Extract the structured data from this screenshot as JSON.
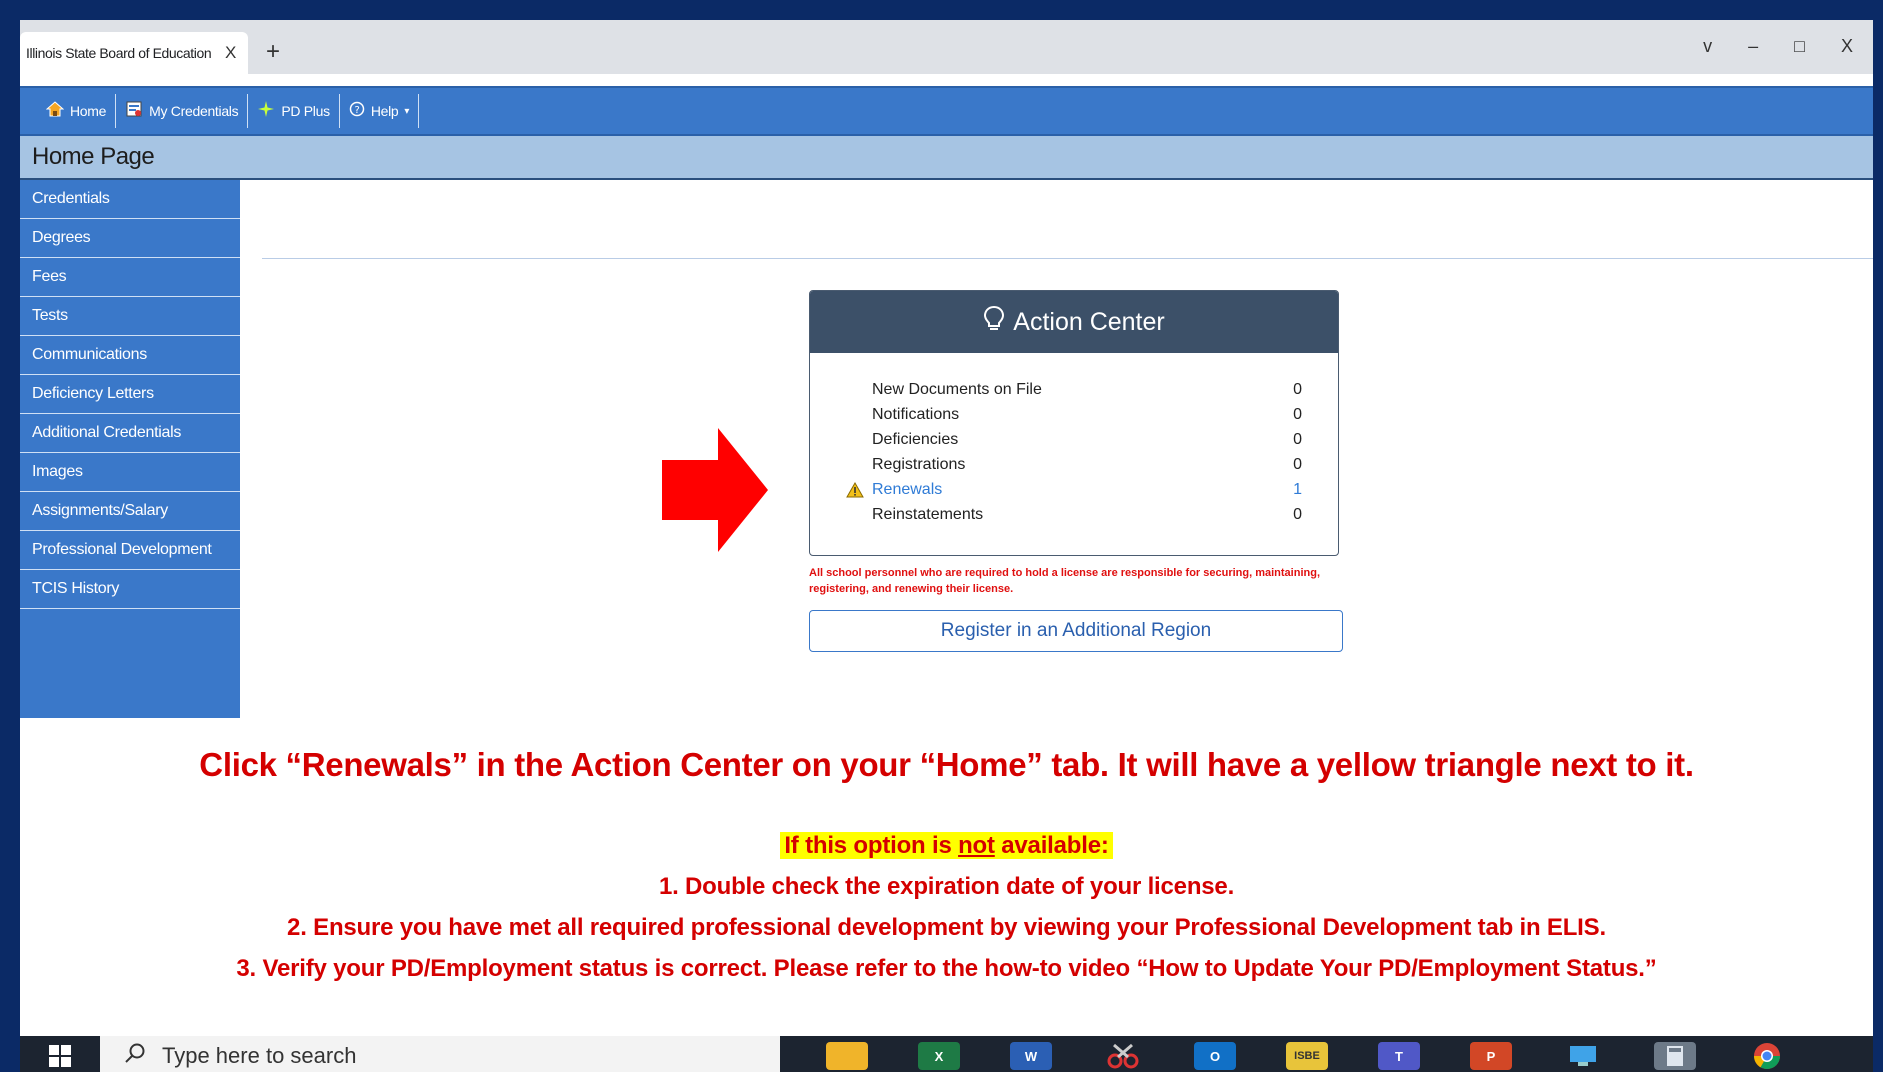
{
  "browser": {
    "tab_title": "Illinois State Board of Education",
    "tab_close": "X",
    "new_tab": "+",
    "window_controls": [
      "v",
      "–",
      "□",
      "X"
    ]
  },
  "nav": [
    {
      "label": "Home",
      "icon": "home-icon"
    },
    {
      "label": "My Credentials",
      "icon": "credentials-icon"
    },
    {
      "label": "PD Plus",
      "icon": "pd-plus-icon"
    },
    {
      "label": "Help",
      "icon": "help-icon"
    }
  ],
  "page_title": "Home Page",
  "sidebar": [
    "Credentials",
    "Degrees",
    "Fees",
    "Tests",
    "Communications",
    "Deficiency Letters",
    "Additional Credentials",
    "Images",
    "Assignments/Salary",
    "Professional Development",
    "TCIS History"
  ],
  "action_center": {
    "title": "Action Center",
    "rows": [
      {
        "label": "New Documents on File",
        "value": "0"
      },
      {
        "label": "Notifications",
        "value": "0"
      },
      {
        "label": "Deficiencies",
        "value": "0"
      },
      {
        "label": "Registrations",
        "value": "0"
      },
      {
        "label": "Renewals",
        "value": "1"
      },
      {
        "label": "Reinstatements",
        "value": "0"
      }
    ],
    "disclaimer": "All school personnel who are required to hold a license are responsible for securing, maintaining, registering, and renewing their license.",
    "register_button": "Register in an Additional Region"
  },
  "instructions": {
    "main": "Click “Renewals” in the Action Center on your “Home” tab.  It will have a yellow triangle next to it.",
    "if_prefix": "If this option is ",
    "if_not": "not",
    "if_suffix": " available:",
    "step1": "1. Double check the expiration date of your license.",
    "step2": "2. Ensure you have met all required professional development by viewing your Professional Development tab in ELIS.",
    "step3": "3. Verify your PD/Employment status is correct.   Please refer to the how-to video “How to Update Your PD/Employment Status.”"
  },
  "taskbar": {
    "search_placeholder": "Type here to search",
    "apps": [
      "file-explorer-icon",
      "excel-icon",
      "word-icon",
      "snipping-tool-icon",
      "outlook-icon",
      "isbe-icon",
      "teams-icon",
      "powerpoint-icon",
      "remote-desktop-icon",
      "calculator-icon",
      "chrome-icon"
    ],
    "isbe_label": "ISBE"
  },
  "colors": {
    "nav_blue": "#3a78c9",
    "action_header": "#3c5068",
    "instruction_red": "#d40000",
    "highlight": "#ffff00",
    "arrow_red": "#ff0000"
  }
}
